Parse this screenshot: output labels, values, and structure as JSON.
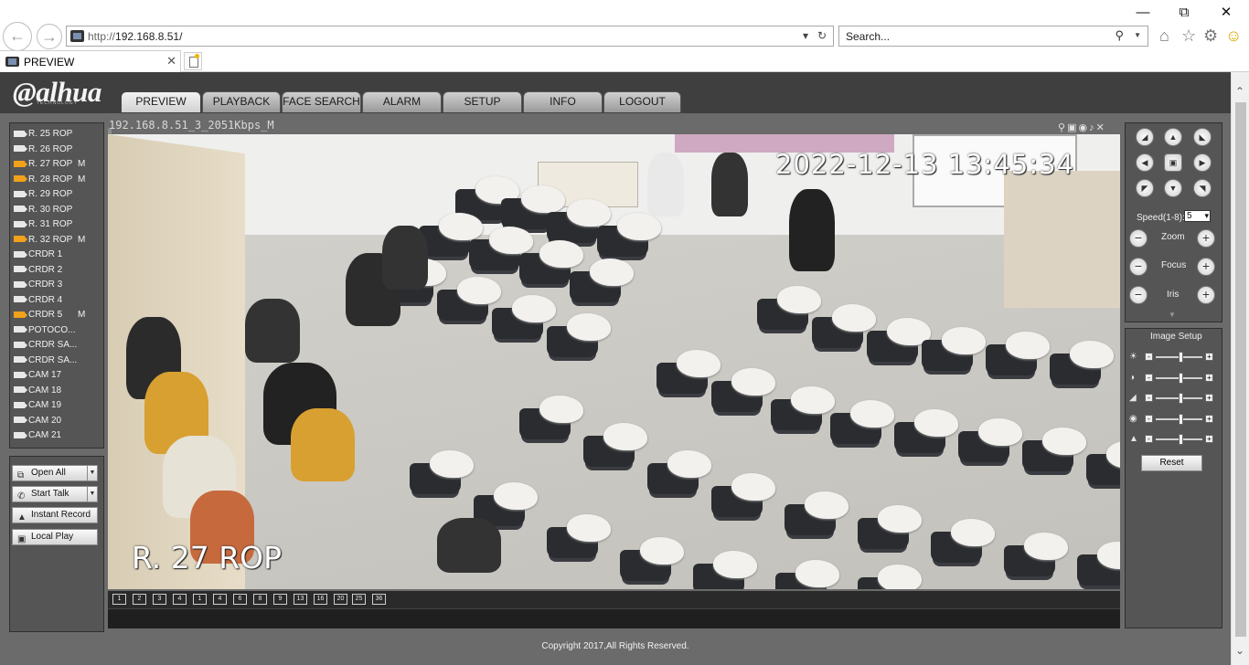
{
  "browser": {
    "url_prefix": "http://",
    "url_host": "192.168.8.51/",
    "search_placeholder": "Search...",
    "tab_title": "PREVIEW",
    "window_controls": [
      "minimize-icon",
      "restore-icon",
      "close-icon"
    ]
  },
  "app": {
    "logo_text": "alhua",
    "logo_sub": "TECHNOLOGY",
    "nav_tabs": [
      "PREVIEW",
      "PLAYBACK",
      "FACE SEARCH",
      "ALARM",
      "SETUP",
      "INFO",
      "LOGOUT"
    ],
    "active_tab": "PREVIEW",
    "accent_color": "#f0a21a"
  },
  "channels": [
    {
      "name": "R. 25 ROP",
      "recording": false,
      "mark": ""
    },
    {
      "name": "R. 26 ROP",
      "recording": false,
      "mark": ""
    },
    {
      "name": "R. 27 ROP",
      "recording": true,
      "mark": "M"
    },
    {
      "name": "R. 28 ROP",
      "recording": true,
      "mark": "M"
    },
    {
      "name": "R. 29 ROP",
      "recording": false,
      "mark": ""
    },
    {
      "name": "R. 30 ROP",
      "recording": false,
      "mark": ""
    },
    {
      "name": "R. 31 ROP",
      "recording": false,
      "mark": ""
    },
    {
      "name": "R. 32 ROP",
      "recording": true,
      "mark": "M"
    },
    {
      "name": "CRDR 1",
      "recording": false,
      "mark": ""
    },
    {
      "name": "CRDR 2",
      "recording": false,
      "mark": ""
    },
    {
      "name": "CRDR 3",
      "recording": false,
      "mark": ""
    },
    {
      "name": "CRDR 4",
      "recording": false,
      "mark": ""
    },
    {
      "name": "CRDR 5",
      "recording": true,
      "mark": "M"
    },
    {
      "name": "POTOCO...",
      "recording": false,
      "mark": ""
    },
    {
      "name": "CRDR SA...",
      "recording": false,
      "mark": ""
    },
    {
      "name": "CRDR SA...",
      "recording": false,
      "mark": ""
    },
    {
      "name": "CAM 17",
      "recording": false,
      "mark": ""
    },
    {
      "name": "CAM 18",
      "recording": false,
      "mark": ""
    },
    {
      "name": "CAM 19",
      "recording": false,
      "mark": ""
    },
    {
      "name": "CAM 20",
      "recording": false,
      "mark": ""
    },
    {
      "name": "CAM 21",
      "recording": false,
      "mark": ""
    }
  ],
  "actions": {
    "open_all": "Open All",
    "start_talk": "Start Talk",
    "instant_record": "Instant Record",
    "local_play": "Local Play"
  },
  "video": {
    "stream_label": "192.168.8.51_3_2051Kbps_M",
    "timestamp": "2022-12-13 13:45:34",
    "channel_title": "R. 27 ROP"
  },
  "split_buttons": [
    "1",
    "2",
    "3",
    "4",
    "1",
    "4",
    "6",
    "8",
    "9",
    "13",
    "16",
    "20",
    "25",
    "36"
  ],
  "ptz": {
    "speed_label": "Speed(1-8):",
    "speed_value": "5",
    "zoom_label": "Zoom",
    "focus_label": "Focus",
    "iris_label": "Iris"
  },
  "image_setup": {
    "title": "Image Setup",
    "controls": [
      {
        "icon": "brightness-icon",
        "level": 0.55
      },
      {
        "icon": "contrast-icon",
        "level": 0.55
      },
      {
        "icon": "saturation-icon",
        "level": 0.55
      },
      {
        "icon": "hue-icon",
        "level": 0.55
      },
      {
        "icon": "sharpness-icon",
        "level": 0.55
      }
    ],
    "reset_label": "Reset"
  },
  "footer": {
    "copyright": "Copyright 2017,All Rights Reserved."
  }
}
